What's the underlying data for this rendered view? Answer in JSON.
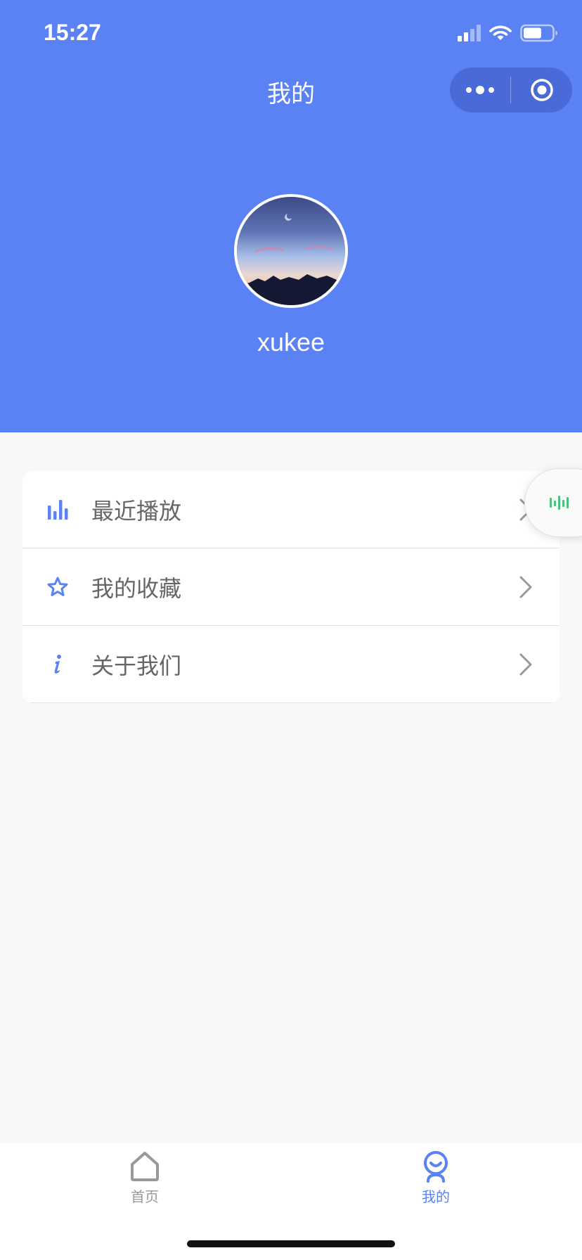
{
  "status_bar": {
    "time": "15:27"
  },
  "nav": {
    "title": "我的"
  },
  "profile": {
    "username": "xukee"
  },
  "menu": [
    {
      "label": "最近播放",
      "icon": "bar-chart-icon"
    },
    {
      "label": "我的收藏",
      "icon": "star-icon"
    },
    {
      "label": "关于我们",
      "icon": "info-icon"
    }
  ],
  "tabbar": [
    {
      "label": "首页",
      "icon": "home-icon",
      "active": false
    },
    {
      "label": "我的",
      "icon": "user-icon",
      "active": true
    }
  ],
  "colors": {
    "header_bg": "#5b82f4",
    "accent": "#5b82f4",
    "page_bg": "#f8f8f8",
    "menu_text": "#666666",
    "inactive_tab": "#999999",
    "audio_green": "#4cc17a"
  }
}
